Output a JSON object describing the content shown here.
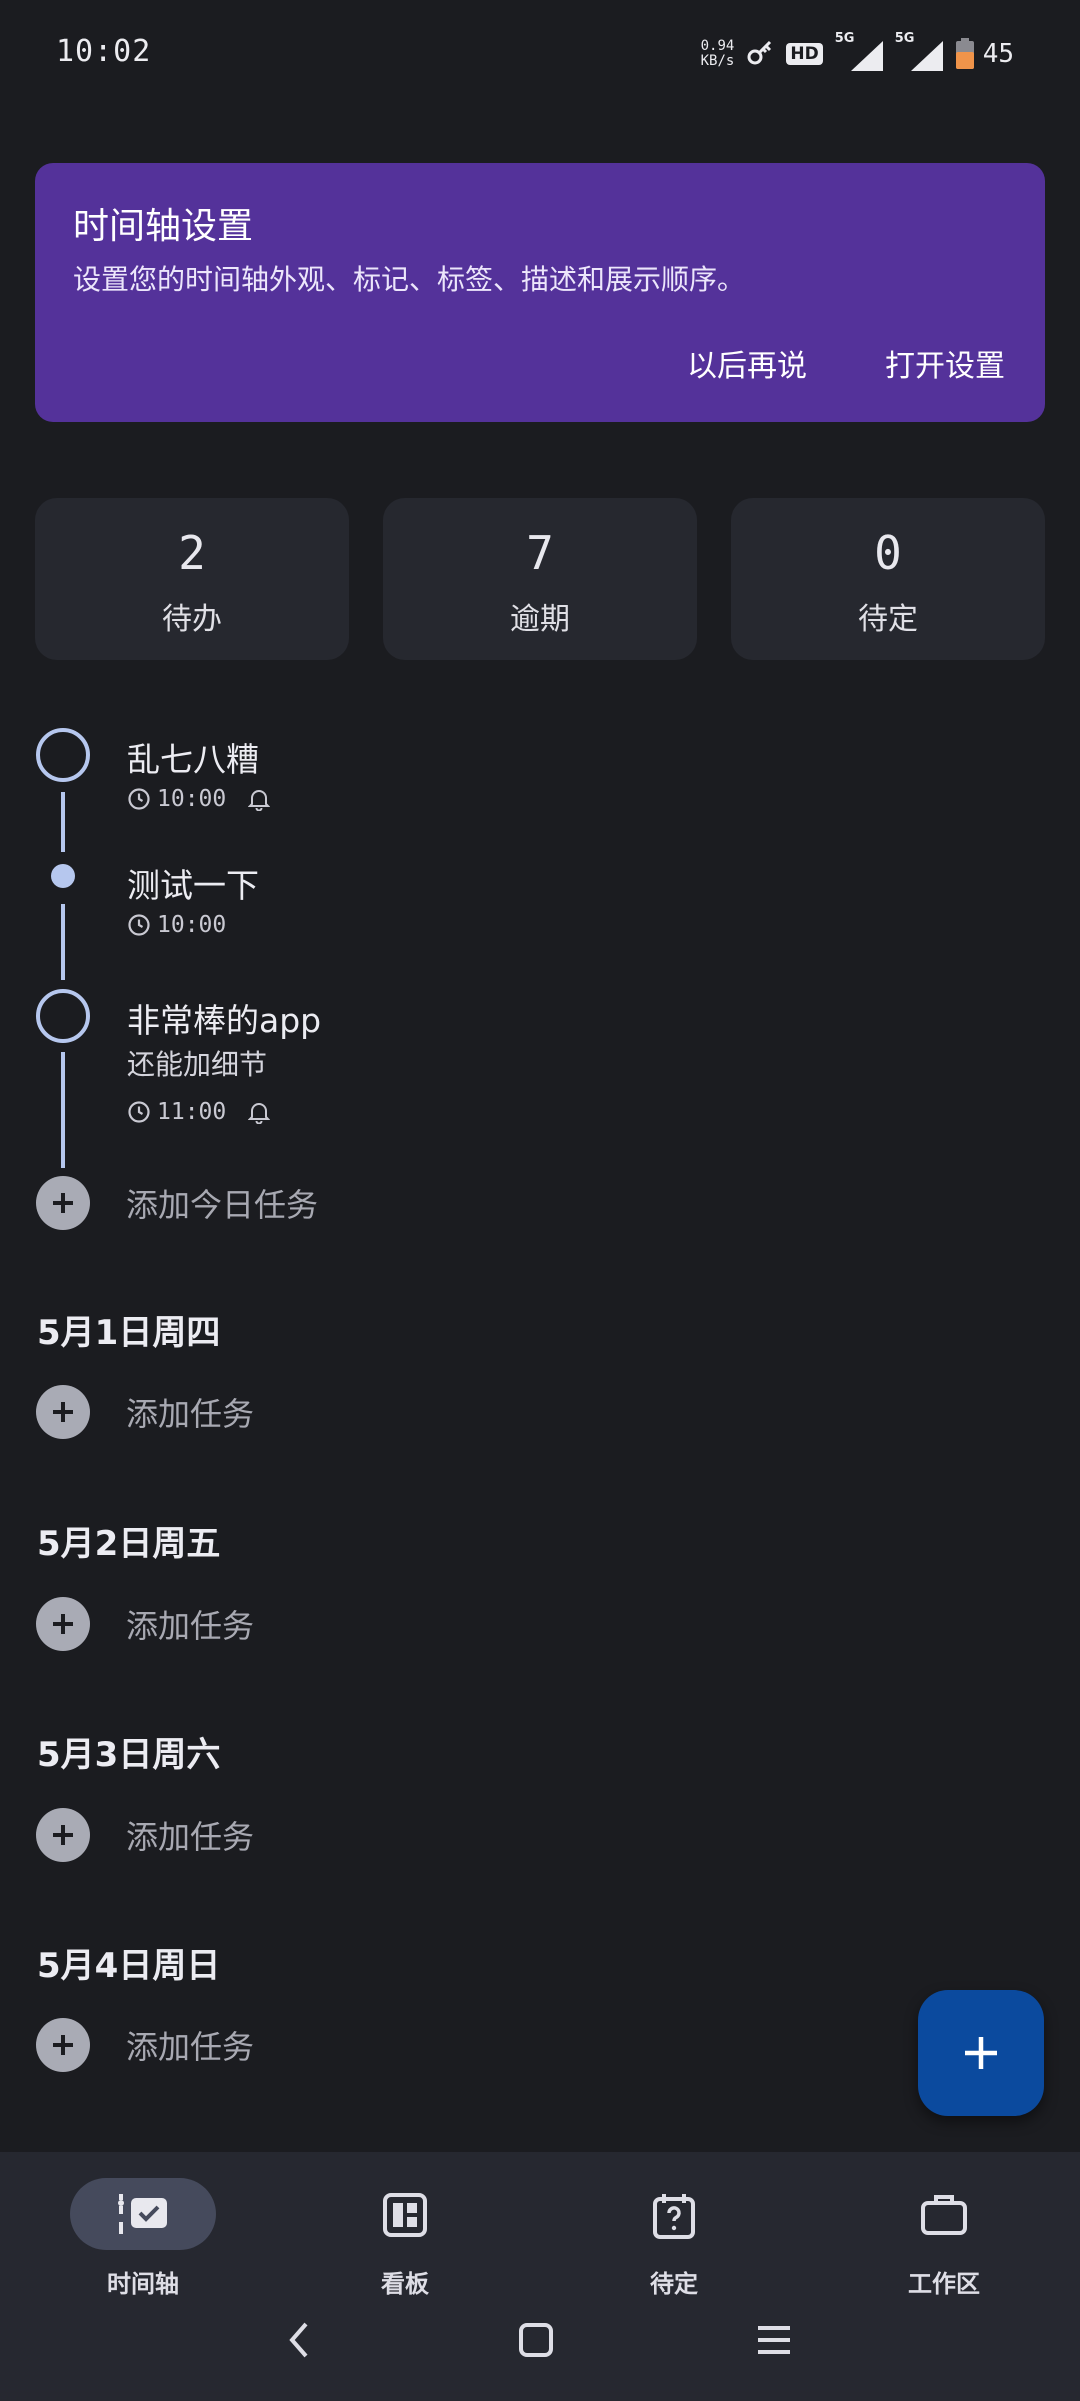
{
  "status_bar": {
    "time": "10:02",
    "net_speed_value": "0.94",
    "net_speed_unit": "KB/s",
    "hd_label": "HD",
    "sim1_label": "5G",
    "sim2_label": "5G",
    "battery_level": "45",
    "battery_color": "#f0944a"
  },
  "banner": {
    "title": "时间轴设置",
    "description": "设置您的时间轴外观、标记、标签、描述和展示顺序。",
    "later_label": "以后再说",
    "open_label": "打开设置",
    "background": "#54329a"
  },
  "stats": [
    {
      "value": "2",
      "label": "待办"
    },
    {
      "value": "7",
      "label": "逾期"
    },
    {
      "value": "0",
      "label": "待定"
    }
  ],
  "timeline": {
    "items": [
      {
        "title": "乱七八糟",
        "time": "10:00",
        "reminder": true,
        "icon": "circle-ring-icon"
      },
      {
        "title": "测试一下",
        "time": "10:00",
        "reminder": false,
        "icon": "filled-dot-icon"
      },
      {
        "title": "非常棒的app",
        "note": "还能加细节",
        "time": "11:00",
        "reminder": true,
        "icon": "circle-ring-icon"
      }
    ],
    "add_today_label": "添加今日任务",
    "accent": "#b6c7ee"
  },
  "days": [
    {
      "heading": "5月1日周四",
      "add_label": "添加任务"
    },
    {
      "heading": "5月2日周五",
      "add_label": "添加任务"
    },
    {
      "heading": "5月3日周六",
      "add_label": "添加任务"
    },
    {
      "heading": "5月4日周日",
      "add_label": "添加任务"
    }
  ],
  "fab": {
    "icon": "plus-icon",
    "color": "#0b4a9e"
  },
  "bottom_nav": [
    {
      "label": "时间轴",
      "icon": "timeline-icon",
      "active": true
    },
    {
      "label": "看板",
      "icon": "board-icon",
      "active": false
    },
    {
      "label": "待定",
      "icon": "calendar-question-icon",
      "active": false
    },
    {
      "label": "工作区",
      "icon": "briefcase-icon",
      "active": false
    }
  ],
  "system_nav": {
    "back": "back-icon",
    "home": "home-icon",
    "menu": "menu-icon"
  }
}
